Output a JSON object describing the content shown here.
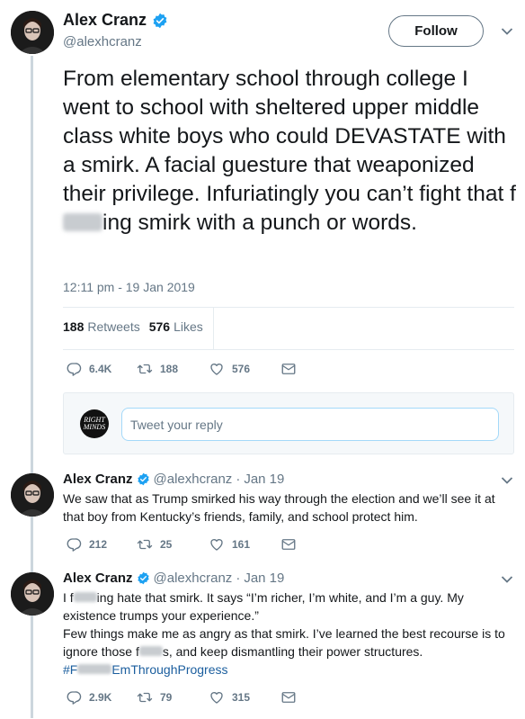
{
  "main_tweet": {
    "name": "Alex Cranz",
    "handle": "@alexhcranz",
    "follow_label": "Follow",
    "text_before": "From elementary school through college I went to school with sheltered upper middle class white boys who could DEVASTATE with a smirk. A facial guesture that weaponized their privilege. Infuriatingly you can’t fight that f",
    "text_after": "ing smirk with a punch or words.",
    "timestamp": "12:11 pm - 19 Jan 2019",
    "retweets_count": "188",
    "retweets_label": "Retweets",
    "likes_count": "576",
    "likes_label": "Likes",
    "actions": {
      "replies": "6.4K",
      "retweets": "188",
      "likes": "576"
    }
  },
  "reply_box": {
    "placeholder": "Tweet your reply",
    "avatar_text": "RIGHT MINDS"
  },
  "replies": [
    {
      "name": "Alex Cranz",
      "handle": "@alexhcranz",
      "dot": "·",
      "date": "Jan 19",
      "text": "We saw that as Trump smirked his way through the election and we’ll see it at that boy from Kentucky’s friends, family, and school protect him.",
      "actions": {
        "replies": "212",
        "retweets": "25",
        "likes": "161"
      }
    },
    {
      "name": "Alex Cranz",
      "handle": "@alexhcranz",
      "dot": "·",
      "date": "Jan 19",
      "line1_a": "I f",
      "line1_b": "ing hate that smirk. It says “I’m richer, I’m white, and I’m a guy. My existence trumps your experience.”",
      "line2_a": "Few things make me as angry as that smirk. I’ve learned the best recourse is to ignore those f",
      "line2_b": "s, and keep dismantling their power structures.",
      "hashtag_a": "#F",
      "hashtag_b": "EmThroughProgress",
      "actions": {
        "replies": "2.9K",
        "retweets": "79",
        "likes": "315"
      }
    }
  ],
  "colors": {
    "verified": "#1da1f2",
    "muted": "#657786",
    "thread_line": "#ccd6dd",
    "hashtag": "#1b5e9e"
  },
  "icons": [
    "verified-badge-icon",
    "chevron-down-icon",
    "reply-icon",
    "retweet-icon",
    "like-heart-icon",
    "direct-message-icon"
  ]
}
